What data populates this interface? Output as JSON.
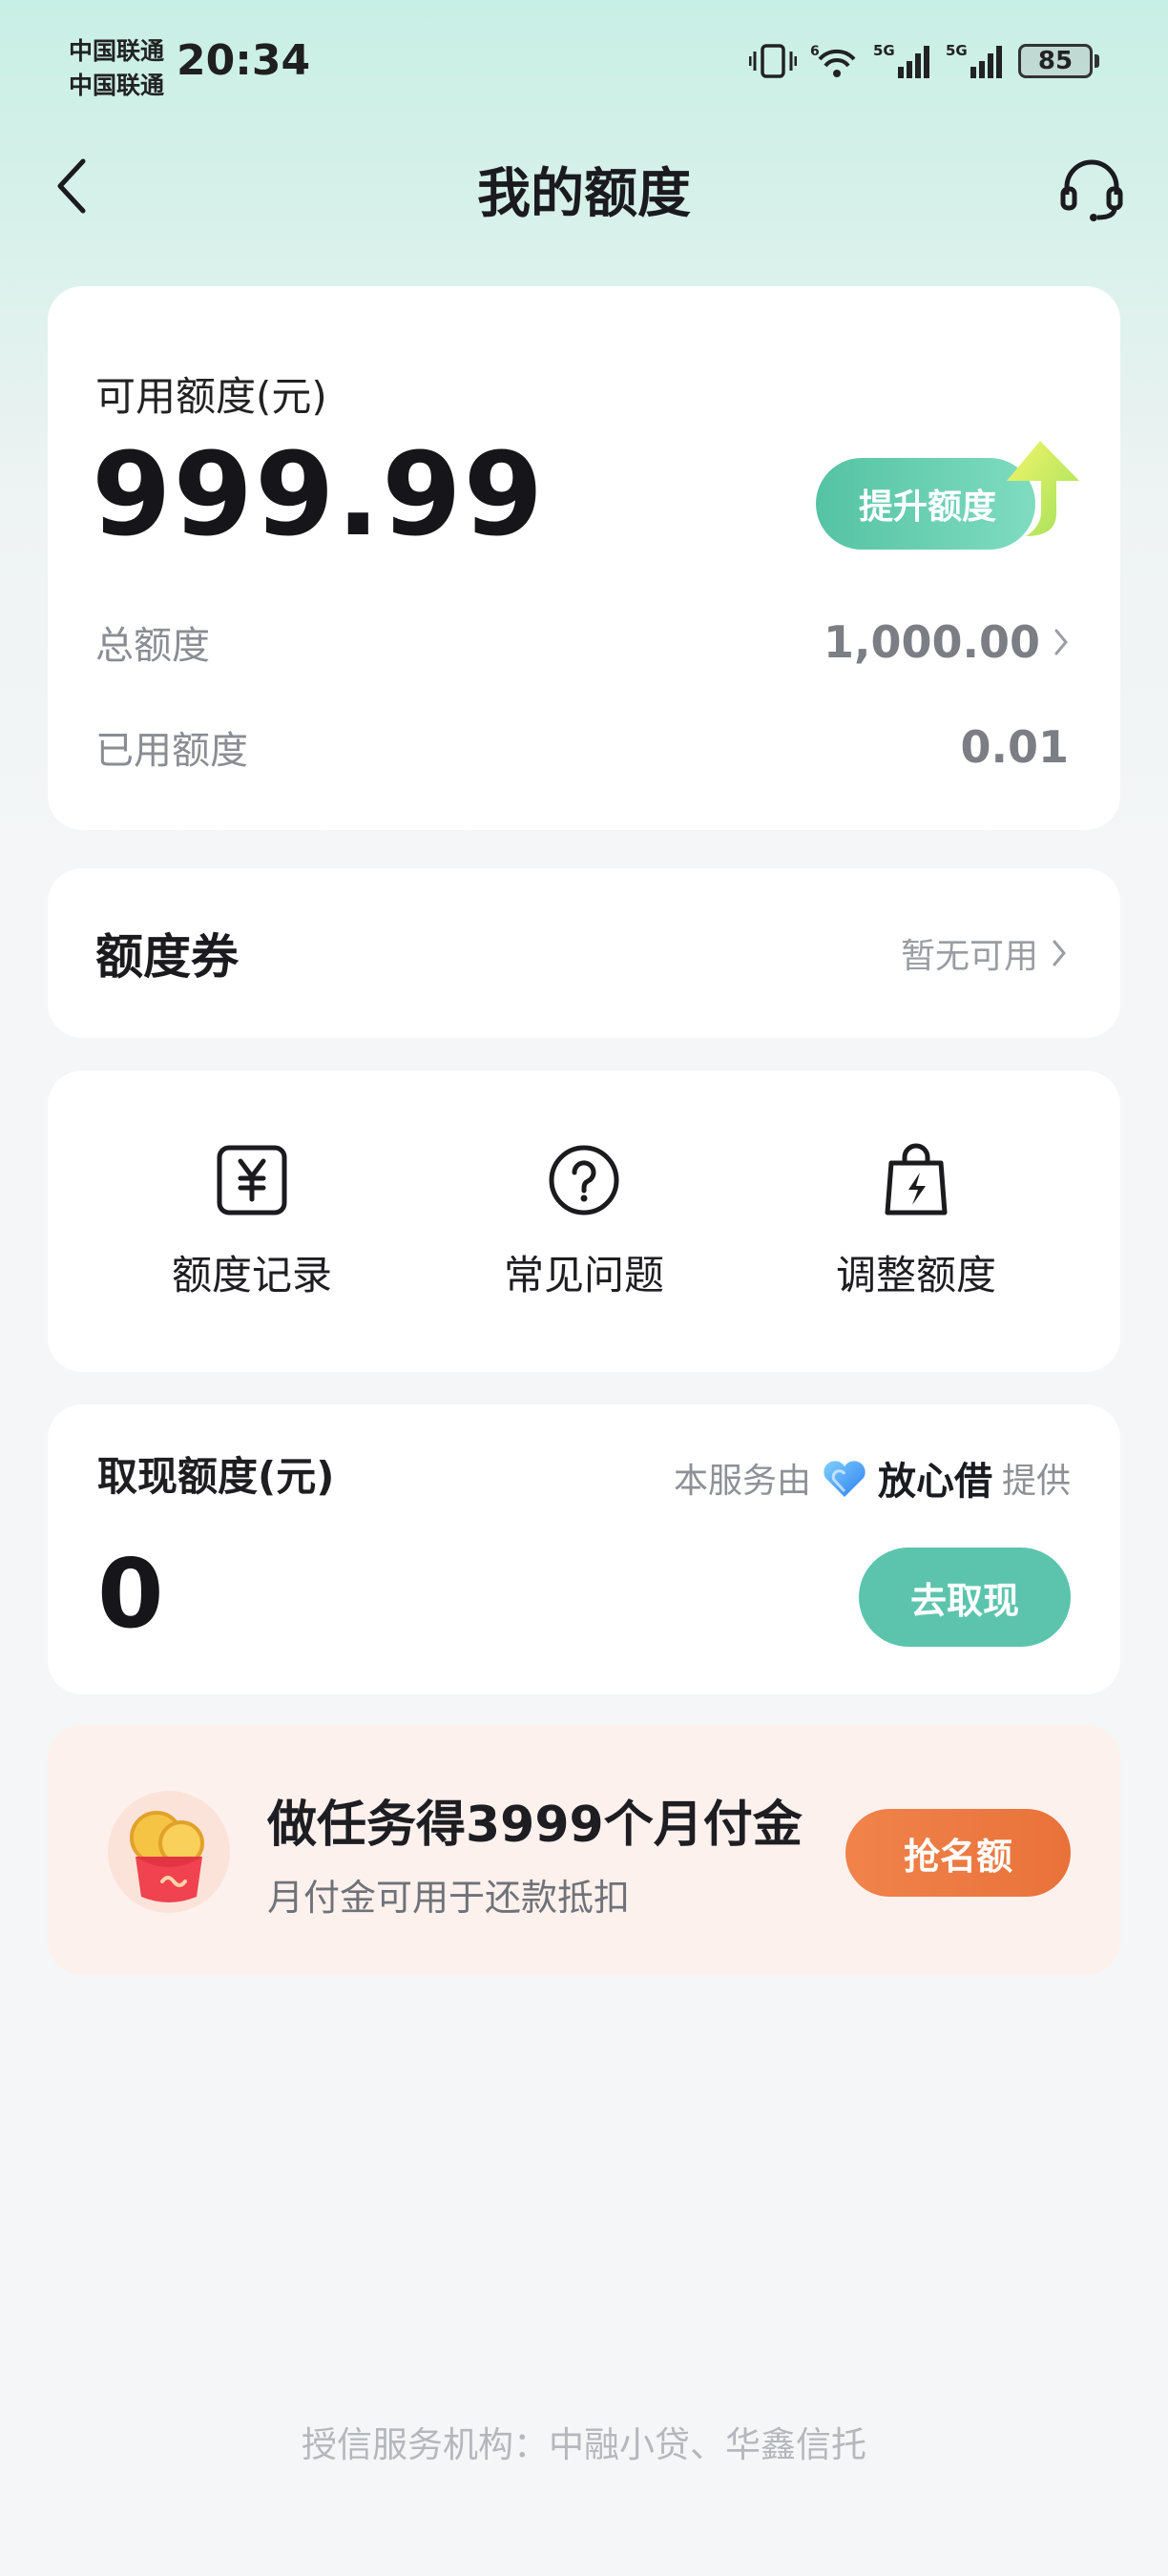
{
  "status_bar": {
    "carrier_1": "中国联通",
    "carrier_2": "中国联通",
    "time": "20:34",
    "battery": "85",
    "icons": [
      "vibrate-icon",
      "wifi-icon",
      "signal-5g-icon",
      "signal-5g-icon",
      "battery-icon"
    ]
  },
  "header": {
    "title": "我的额度",
    "back_icon": "chevron-left-icon",
    "support_icon": "headset-icon"
  },
  "credit": {
    "available_label": "可用额度(元)",
    "available_amount": "999.99",
    "raise_button": "提升额度",
    "total_label": "总额度",
    "total_value": "1,000.00",
    "used_label": "已用额度",
    "used_value": "0.01"
  },
  "coupon": {
    "title": "额度券",
    "status": "暂无可用"
  },
  "quick_actions": [
    {
      "label": "额度记录",
      "icon": "yuan-record-icon"
    },
    {
      "label": "常见问题",
      "icon": "question-circle-icon"
    },
    {
      "label": "调整额度",
      "icon": "lightning-bag-icon"
    }
  ],
  "withdraw": {
    "label": "取现额度(元)",
    "provider_prefix": "本服务由",
    "provider_name": "放心借",
    "provider_suffix": "提供",
    "amount": "0",
    "button": "去取现"
  },
  "promo": {
    "title": "做任务得3999个月付金",
    "subtitle": "月付金可用于还款抵扣",
    "button": "抢名额"
  },
  "footer": {
    "text": "授信服务机构：中融小贷、华鑫信托"
  },
  "colors": {
    "accent_green": "#5cc4ad",
    "promo_orange": "#ee7c45",
    "header_mint": "#c8efe5"
  }
}
